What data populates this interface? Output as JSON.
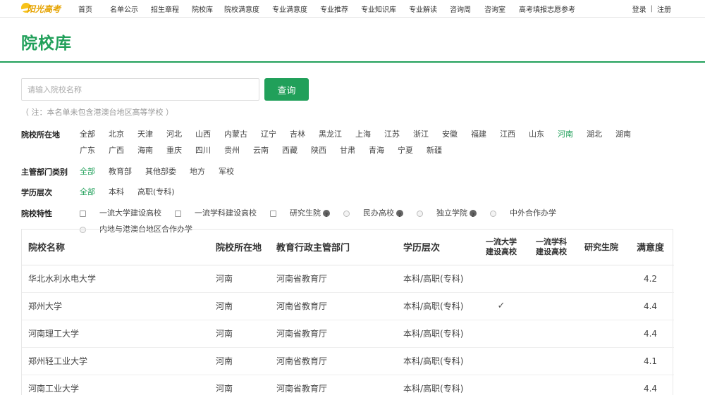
{
  "logo": {
    "text": "阳光高考"
  },
  "nav": {
    "items": [
      "首页",
      "名单公示",
      "招生章程",
      "院校库",
      "院校满意度",
      "专业满意度",
      "专业推荐",
      "专业知识库",
      "专业解读",
      "咨询周",
      "咨询室",
      "高考填报志愿参考"
    ],
    "login": "登录",
    "separator": "|",
    "register": "注册"
  },
  "page": {
    "title": "院校库"
  },
  "search": {
    "placeholder": "请输入院校名称",
    "button": "查询",
    "note": "（ 注：本名单未包含港澳台地区高等学校 ）"
  },
  "filters": {
    "location": {
      "label": "院校所在地",
      "options": [
        "全部",
        "北京",
        "天津",
        "河北",
        "山西",
        "内蒙古",
        "辽宁",
        "吉林",
        "黑龙江",
        "上海",
        "江苏",
        "浙江",
        "安徽",
        "福建",
        "江西",
        "山东",
        "河南",
        "湖北",
        "湖南",
        "广东",
        "广西",
        "海南",
        "重庆",
        "四川",
        "贵州",
        "云南",
        "西藏",
        "陕西",
        "甘肃",
        "青海",
        "宁夏",
        "新疆"
      ],
      "active": "河南"
    },
    "department": {
      "label": "主管部门类别",
      "options": [
        "全部",
        "教育部",
        "其他部委",
        "地方",
        "军校"
      ],
      "active": "全部"
    },
    "level": {
      "label": "学历层次",
      "options": [
        "全部",
        "本科",
        "高职(专科)"
      ],
      "active": "全部"
    },
    "traits": {
      "label": "院校特性",
      "items": [
        {
          "label": "一流大学建设高校",
          "control": "checkbox",
          "help": false
        },
        {
          "label": "一流学科建设高校",
          "control": "checkbox",
          "help": false
        },
        {
          "label": "研究生院",
          "control": "checkbox",
          "help": true
        },
        {
          "label": "民办高校",
          "control": "radio",
          "help": true
        },
        {
          "label": "独立学院",
          "control": "radio",
          "help": true
        },
        {
          "label": "中外合作办学",
          "control": "radio",
          "help": false
        },
        {
          "label": "内地与港澳台地区合作办学",
          "control": "radio",
          "help": false
        }
      ],
      "help_glyph": "?"
    }
  },
  "table": {
    "headers": {
      "name": "院校名称",
      "location": "院校所在地",
      "dept": "教育行政主管部门",
      "level": "学历层次",
      "first_class_univ": [
        "一流大学",
        "建设高校"
      ],
      "first_class_subject": [
        "一流学科",
        "建设高校"
      ],
      "grad_school": "研究生院",
      "satisfaction": "满意度"
    },
    "check_glyph": "✓",
    "rows": [
      {
        "name": "华北水利水电大学",
        "location": "河南",
        "dept": "河南省教育厅",
        "level": "本科/高职(专科)",
        "first_class_univ": false,
        "first_class_subject": false,
        "grad_school": false,
        "satisfaction": "4.2"
      },
      {
        "name": "郑州大学",
        "location": "河南",
        "dept": "河南省教育厅",
        "level": "本科/高职(专科)",
        "first_class_univ": true,
        "first_class_subject": false,
        "grad_school": false,
        "satisfaction": "4.4"
      },
      {
        "name": "河南理工大学",
        "location": "河南",
        "dept": "河南省教育厅",
        "level": "本科/高职(专科)",
        "first_class_univ": false,
        "first_class_subject": false,
        "grad_school": false,
        "satisfaction": "4.4"
      },
      {
        "name": "郑州轻工业大学",
        "location": "河南",
        "dept": "河南省教育厅",
        "level": "本科/高职(专科)",
        "first_class_univ": false,
        "first_class_subject": false,
        "grad_school": false,
        "satisfaction": "4.1"
      },
      {
        "name": "河南工业大学",
        "location": "河南",
        "dept": "河南省教育厅",
        "level": "本科/高职(专科)",
        "first_class_univ": false,
        "first_class_subject": false,
        "grad_school": false,
        "satisfaction": "4.4"
      }
    ]
  },
  "colors": {
    "accent": "#21a05a",
    "logo": "#e6a300"
  }
}
